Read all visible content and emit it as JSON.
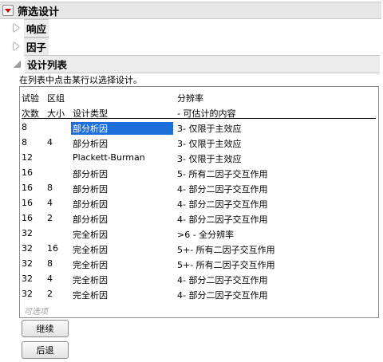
{
  "header": {
    "title": "筛选设计"
  },
  "sections": {
    "response": "响应",
    "factors": "因子",
    "design_list": "设计列表"
  },
  "note": "在列表中点击某行以选择设计。",
  "columns": {
    "runs_top": "试验",
    "runs_bottom": "次数",
    "block_top": "区组",
    "block_bottom": "大小",
    "type": "设计类型",
    "res_top": "分辨率",
    "res_bottom": "- 可估计的内容"
  },
  "rows": [
    {
      "runs": "8",
      "block": "",
      "type": "部分析因",
      "res": "3- 仅限于主效应"
    },
    {
      "runs": "8",
      "block": "4",
      "type": "部分析因",
      "res": "3- 仅限于主效应"
    },
    {
      "runs": "12",
      "block": "",
      "type": "Plackett-Burman",
      "res": "3- 仅限于主效应"
    },
    {
      "runs": "16",
      "block": "",
      "type": "部分析因",
      "res": "5- 所有二因子交互作用"
    },
    {
      "runs": "16",
      "block": "8",
      "type": "部分析因",
      "res": "4- 部分二因子交互作用"
    },
    {
      "runs": "16",
      "block": "4",
      "type": "部分析因",
      "res": "4- 部分二因子交互作用"
    },
    {
      "runs": "16",
      "block": "2",
      "type": "部分析因",
      "res": "4- 部分二因子交互作用"
    },
    {
      "runs": "32",
      "block": "",
      "type": "完全析因",
      "res": ">6 - 全分辨率"
    },
    {
      "runs": "32",
      "block": "16",
      "type": "完全析因",
      "res": "5+- 所有二因子交互作用"
    },
    {
      "runs": "32",
      "block": "8",
      "type": "完全析因",
      "res": "5+- 所有二因子交互作用"
    },
    {
      "runs": "32",
      "block": "4",
      "type": "完全析因",
      "res": "4- 部分二因子交互作用"
    },
    {
      "runs": "32",
      "block": "2",
      "type": "完全析因",
      "res": "4- 部分二因子交互作用"
    }
  ],
  "selected_row": 0,
  "optional_label": "可选项",
  "buttons": {
    "continue": "继续",
    "back": "后退"
  },
  "colors": {
    "selection": "#1e6fd9",
    "disclosure_red": "#d40000"
  }
}
